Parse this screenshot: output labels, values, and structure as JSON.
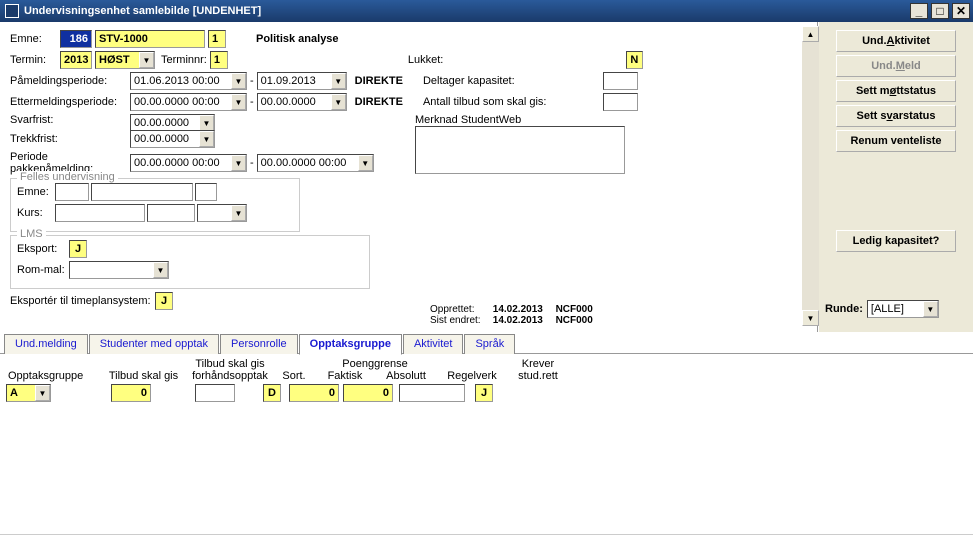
{
  "window": {
    "title": "Undervisningsenhet samlebilde [UNDENHET]"
  },
  "top": {
    "emne_lbl": "Emne:",
    "emne_code": "186",
    "emne_kurs": "STV-1000",
    "emne_num": "1",
    "emne_title": "Politisk analyse",
    "termin_lbl": "Termin:",
    "termin_year": "2013",
    "termin_sem": "HØST",
    "terminnr_lbl": "Terminnr:",
    "terminnr": "1",
    "lukket_lbl": "Lukket:",
    "lukket_val": "N",
    "pamelding_lbl": "Påmeldingsperiode:",
    "pamelding_from": "01.06.2013 00:00",
    "pamelding_to": "01.09.2013",
    "pamelding_type": "DIREKTE",
    "etter_lbl": "Ettermeldingsperiode:",
    "etter_from": "00.00.0000 00:00",
    "etter_to": "00.00.0000",
    "etter_type": "DIREKTE",
    "svar_lbl": "Svarfrist:",
    "svar_val": "00.00.0000",
    "trekk_lbl": "Trekkfrist:",
    "trekk_val": "00.00.0000",
    "pakke_lbl": "Periode pakkepåmelding:",
    "pakke_from": "00.00.0000 00:00",
    "pakke_to": "00.00.0000 00:00",
    "deltager_lbl": "Deltager kapasitet:",
    "antall_lbl": "Antall tilbud som skal gis:",
    "merknad_lbl": "Merknad StudentWeb",
    "felles_legend": "Felles undervisning",
    "felles_emne": "Emne:",
    "felles_kurs": "Kurs:",
    "lms_legend": "LMS",
    "lms_eksport": "Eksport:",
    "lms_eksport_val": "J",
    "lms_rommal": "Rom-mal:",
    "eksporter_lbl": "Eksportér til timeplansystem:",
    "eksporter_val": "J",
    "opprettet_lbl": "Opprettet:",
    "opprettet_date": "14.02.2013",
    "opprettet_user": "NCF000",
    "sistendret_lbl": "Sist endret:",
    "sistendret_date": "14.02.2013",
    "sistendret_user": "NCF000"
  },
  "buttons": {
    "aktivitet_pre": "Und.",
    "aktivitet_u": "A",
    "aktivitet_post": "ktivitet",
    "meld_pre": "Und.",
    "meld_u": "M",
    "meld_post": "eld",
    "mott": "Sett m",
    "mott_u": "ø",
    "mott_post": "ttstatus",
    "svar": "Sett s",
    "svar_u": "v",
    "svar_post": "arstatus",
    "renum": "Renum venteliste",
    "ledig": "Ledig kapasitet?",
    "runde_lbl": "Runde:",
    "runde_val": "[ALLE]"
  },
  "tabs": {
    "t1": "Und.melding",
    "t2": "Studenter med opptak",
    "t3": "Personrolle",
    "t4": "Opptaksgruppe",
    "t5": "Aktivitet",
    "t6": "Språk"
  },
  "grid": {
    "h1": "Opptaksgruppe",
    "h2": "Tilbud skal gis",
    "h3a": "Tilbud skal gis",
    "h3b": "forhåndsopptak",
    "h4": "Sort.",
    "h5a": "Poenggrense",
    "h5": "Faktisk",
    "h6": "Absolutt",
    "h7": "Regelverk",
    "h8a": "Krever",
    "h8": "stud.rett",
    "r_opptak": "A",
    "r_tilbud": "0",
    "r_forhand": "",
    "r_sort": "D",
    "r_faktisk": "0",
    "r_abs": "0",
    "r_regel": "",
    "r_stud": "J"
  }
}
